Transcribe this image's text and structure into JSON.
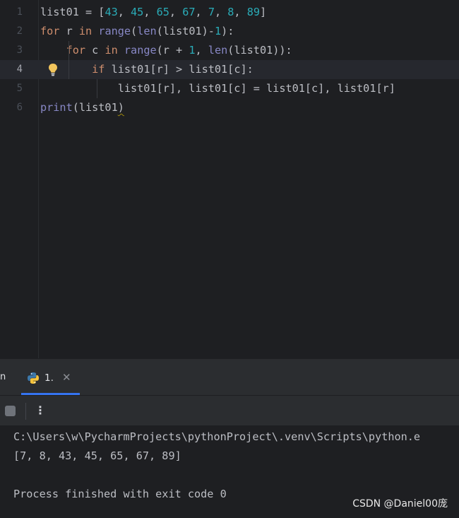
{
  "editor": {
    "line_numbers": [
      "1",
      "2",
      "3",
      "4",
      "5",
      "6"
    ],
    "lines": [
      {
        "id": 1,
        "tokens": [
          {
            "t": "list01 = [",
            "c": ""
          },
          {
            "t": "43",
            "c": "num"
          },
          {
            "t": ", ",
            "c": ""
          },
          {
            "t": "45",
            "c": "num"
          },
          {
            "t": ", ",
            "c": ""
          },
          {
            "t": "65",
            "c": "num"
          },
          {
            "t": ", ",
            "c": ""
          },
          {
            "t": "67",
            "c": "num"
          },
          {
            "t": ", ",
            "c": ""
          },
          {
            "t": "7",
            "c": "num"
          },
          {
            "t": ", ",
            "c": ""
          },
          {
            "t": "8",
            "c": "num"
          },
          {
            "t": ", ",
            "c": ""
          },
          {
            "t": "89",
            "c": "num"
          },
          {
            "t": "]",
            "c": ""
          }
        ]
      },
      {
        "id": 2,
        "tokens": [
          {
            "t": "for",
            "c": "kw"
          },
          {
            "t": " r ",
            "c": ""
          },
          {
            "t": "in",
            "c": "kw"
          },
          {
            "t": " ",
            "c": ""
          },
          {
            "t": "range",
            "c": "bi"
          },
          {
            "t": "(",
            "c": ""
          },
          {
            "t": "len",
            "c": "bi"
          },
          {
            "t": "(list01)-",
            "c": ""
          },
          {
            "t": "1",
            "c": "num"
          },
          {
            "t": "):",
            "c": ""
          }
        ]
      },
      {
        "id": 3,
        "tokens": [
          {
            "t": "    ",
            "c": ""
          },
          {
            "t": "for",
            "c": "kw"
          },
          {
            "t": " c ",
            "c": ""
          },
          {
            "t": "in",
            "c": "kw"
          },
          {
            "t": " ",
            "c": ""
          },
          {
            "t": "range",
            "c": "bi"
          },
          {
            "t": "(r + ",
            "c": ""
          },
          {
            "t": "1",
            "c": "num"
          },
          {
            "t": ", ",
            "c": ""
          },
          {
            "t": "len",
            "c": "bi"
          },
          {
            "t": "(list01)):",
            "c": ""
          }
        ]
      },
      {
        "id": 4,
        "tokens": [
          {
            "t": "        ",
            "c": ""
          },
          {
            "t": "if",
            "c": "kw"
          },
          {
            "t": " list01[r] > list01[c]:",
            "c": ""
          }
        ]
      },
      {
        "id": 5,
        "tokens": [
          {
            "t": "            list01[r], list01[c] = list01[c], list01[r]",
            "c": ""
          }
        ]
      },
      {
        "id": 6,
        "tokens": [
          {
            "t": "print",
            "c": "bi"
          },
          {
            "t": "(list01",
            "c": ""
          },
          {
            "t": ")",
            "c": "squiggle"
          }
        ]
      }
    ],
    "current_line": 4,
    "hint_icon": "lightbulb-icon"
  },
  "tool_window": {
    "left_tab_fragment": "n",
    "run_tab": {
      "label": "1.",
      "close": "✕",
      "icon": "python-icon"
    }
  },
  "toolbar": {
    "stop_icon": "stop-icon",
    "more_label": "⋮"
  },
  "console": {
    "lines": [
      "C:\\Users\\w\\PycharmProjects\\pythonProject\\.venv\\Scripts\\python.e",
      "[7, 8, 43, 45, 65, 67, 89]",
      "",
      "Process finished with exit code 0"
    ]
  },
  "watermark": "CSDN @Daniel00庞",
  "colors": {
    "background": "#1e1f22",
    "panel": "#2b2d30",
    "keyword": "#cf8e6d",
    "builtin": "#8888c6",
    "number": "#2aacb8",
    "text": "#bcbec4",
    "accent": "#3574f0"
  }
}
